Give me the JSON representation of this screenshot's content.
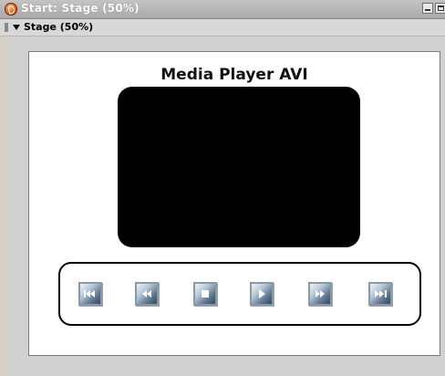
{
  "window": {
    "title": "Start: Stage (50%)",
    "icon": "app-logo-icon"
  },
  "panel": {
    "title": "Stage (50%)"
  },
  "stage": {
    "heading": "Media Player AVI"
  },
  "controls": [
    {
      "name": "skip-back-button",
      "icon": "skip-back-icon"
    },
    {
      "name": "rewind-button",
      "icon": "rewind-icon"
    },
    {
      "name": "stop-button",
      "icon": "stop-icon"
    },
    {
      "name": "play-button",
      "icon": "play-icon"
    },
    {
      "name": "fast-forward-button",
      "icon": "fast-forward-icon"
    },
    {
      "name": "skip-forward-button",
      "icon": "skip-forward-icon"
    }
  ],
  "colors": {
    "screen": "#000000",
    "button_dark": "#33495f",
    "button_light": "#eef3f8"
  }
}
